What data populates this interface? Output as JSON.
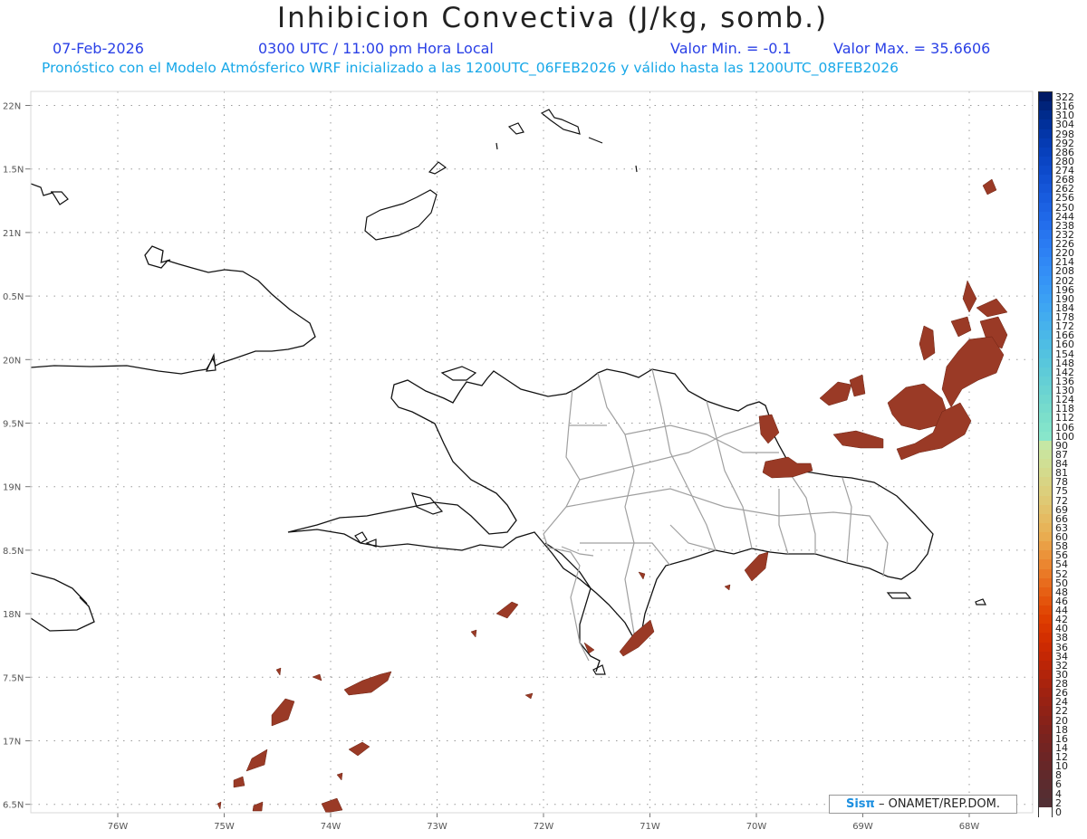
{
  "header": {
    "title": "Inhibicion Convectiva (J/kg, somb.)",
    "date": "07-Feb-2026",
    "time": "0300 UTC / 11:00 pm Hora Local",
    "valor_min": "Valor Min. = -0.1",
    "valor_max": "Valor Max. = 35.6606",
    "model_info": "Pronóstico con el Modelo Atmósferico WRF inicializado a las 1200UTC_06FEB2026 y válido hasta las  1200UTC_08FEB2026"
  },
  "map": {
    "lat_labels": [
      "22N",
      "1.5N",
      "21N",
      "0.5N",
      "20N",
      "9.5N",
      "19N",
      "8.5N",
      "18N",
      "7.5N",
      "17N",
      "6.5N"
    ],
    "lon_labels": [
      "76W",
      "75W",
      "74W",
      "73W",
      "72W",
      "71W",
      "70W",
      "69W",
      "68W"
    ],
    "lon_range": [
      -76.8,
      -67.4
    ],
    "lat_range": [
      16.4,
      22.1
    ],
    "grid": true,
    "colors": {
      "coast": "#111111",
      "borders": "#a0a0a0",
      "grid": "#9a9a9a",
      "cin_fill": "#9a3a26"
    }
  },
  "colorbar": {
    "labels": [
      "322",
      "316",
      "310",
      "304",
      "298",
      "292",
      "286",
      "280",
      "274",
      "268",
      "262",
      "256",
      "250",
      "244",
      "238",
      "232",
      "226",
      "220",
      "214",
      "208",
      "202",
      "196",
      "190",
      "184",
      "178",
      "172",
      "166",
      "160",
      "154",
      "148",
      "142",
      "136",
      "130",
      "124",
      "118",
      "112",
      "106",
      "100",
      "90",
      "87",
      "84",
      "81",
      "78",
      "75",
      "72",
      "69",
      "66",
      "63",
      "60",
      "58",
      "56",
      "54",
      "52",
      "50",
      "48",
      "46",
      "44",
      "42",
      "40",
      "38",
      "36",
      "34",
      "32",
      "30",
      "28",
      "26",
      "24",
      "22",
      "20",
      "18",
      "16",
      "14",
      "12",
      "10",
      "8",
      "6",
      "4",
      "2",
      "0"
    ],
    "colors": [
      "#001a66",
      "#00237a",
      "#002b8c",
      "#01309b",
      "#0336a8",
      "#053bb3",
      "#0740bc",
      "#0a45c4",
      "#0d4acb",
      "#1150d2",
      "#1556d8",
      "#185cde",
      "#1c62e3",
      "#1f68e8",
      "#236eec",
      "#2775ef",
      "#2a7bf2",
      "#2d81f4",
      "#3088f5",
      "#338ef6",
      "#3594f6",
      "#389af5",
      "#3ba0f4",
      "#3ea6f2",
      "#42acef",
      "#46b2ec",
      "#4ab7e8",
      "#4ebde4",
      "#53c2e0",
      "#58c7dc",
      "#5ecbd8",
      "#64cfd5",
      "#6ad3d2",
      "#70d7cf",
      "#76dbcd",
      "#7cdfcb",
      "#82e3cb",
      "#88e6cb",
      "#c6e7a4",
      "#cbe39c",
      "#d0df94",
      "#d4da8c",
      "#d8d484",
      "#dccf7c",
      "#dfc974",
      "#e2c26b",
      "#e5bb62",
      "#e7b459",
      "#e9ac50",
      "#ea9f45",
      "#eb933a",
      "#eb8630",
      "#ea7926",
      "#e86c1d",
      "#e66014",
      "#e4540c",
      "#e14805",
      "#de3e00",
      "#d93600",
      "#d32f00",
      "#cc2a02",
      "#c42704",
      "#bb2507",
      "#b2240a",
      "#a9230d",
      "#a02210",
      "#982213",
      "#902216",
      "#882219",
      "#80221c",
      "#79231f",
      "#732422",
      "#6d2525",
      "#672728",
      "#61292b",
      "#5c2b2e",
      "#572d31",
      "#522f34",
      "#ffffff"
    ]
  },
  "credit": {
    "logo": "Sisπ",
    "text": "– ONAMET/REP.DOM."
  }
}
